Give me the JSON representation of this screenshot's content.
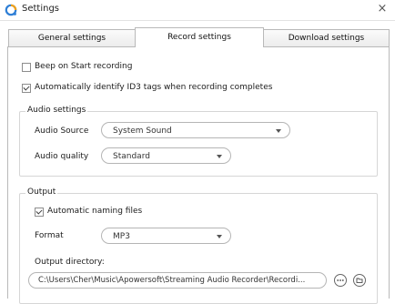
{
  "window": {
    "title": "Settings",
    "close_glyph": "×"
  },
  "tabs": [
    {
      "label": "General settings",
      "active": false
    },
    {
      "label": "Record settings",
      "active": true
    },
    {
      "label": "Download settings",
      "active": false
    }
  ],
  "record": {
    "beep_label": "Beep on Start recording",
    "beep_checked": false,
    "id3_label": "Automatically identify ID3 tags when recording completes",
    "id3_checked": true
  },
  "audio_settings": {
    "title": "Audio settings",
    "source_label": "Audio Source",
    "source_value": "System Sound",
    "quality_label": "Audio quality",
    "quality_value": "Standard"
  },
  "output": {
    "title": "Output",
    "auto_naming_label": "Automatic naming files",
    "auto_naming_checked": true,
    "format_label": "Format",
    "format_value": "MP3",
    "directory_label": "Output directory:",
    "directory_value": "C:\\Users\\Cher\\Music\\Apowersoft\\Streaming Audio Recorder\\Recordi...",
    "browse_icon": "more-options-icon",
    "open_folder_icon": "folder-icon"
  },
  "colors": {
    "app_icon_blue": "#2f7fd6",
    "app_icon_orange": "#f2a21b",
    "border": "#b9b9b9"
  }
}
